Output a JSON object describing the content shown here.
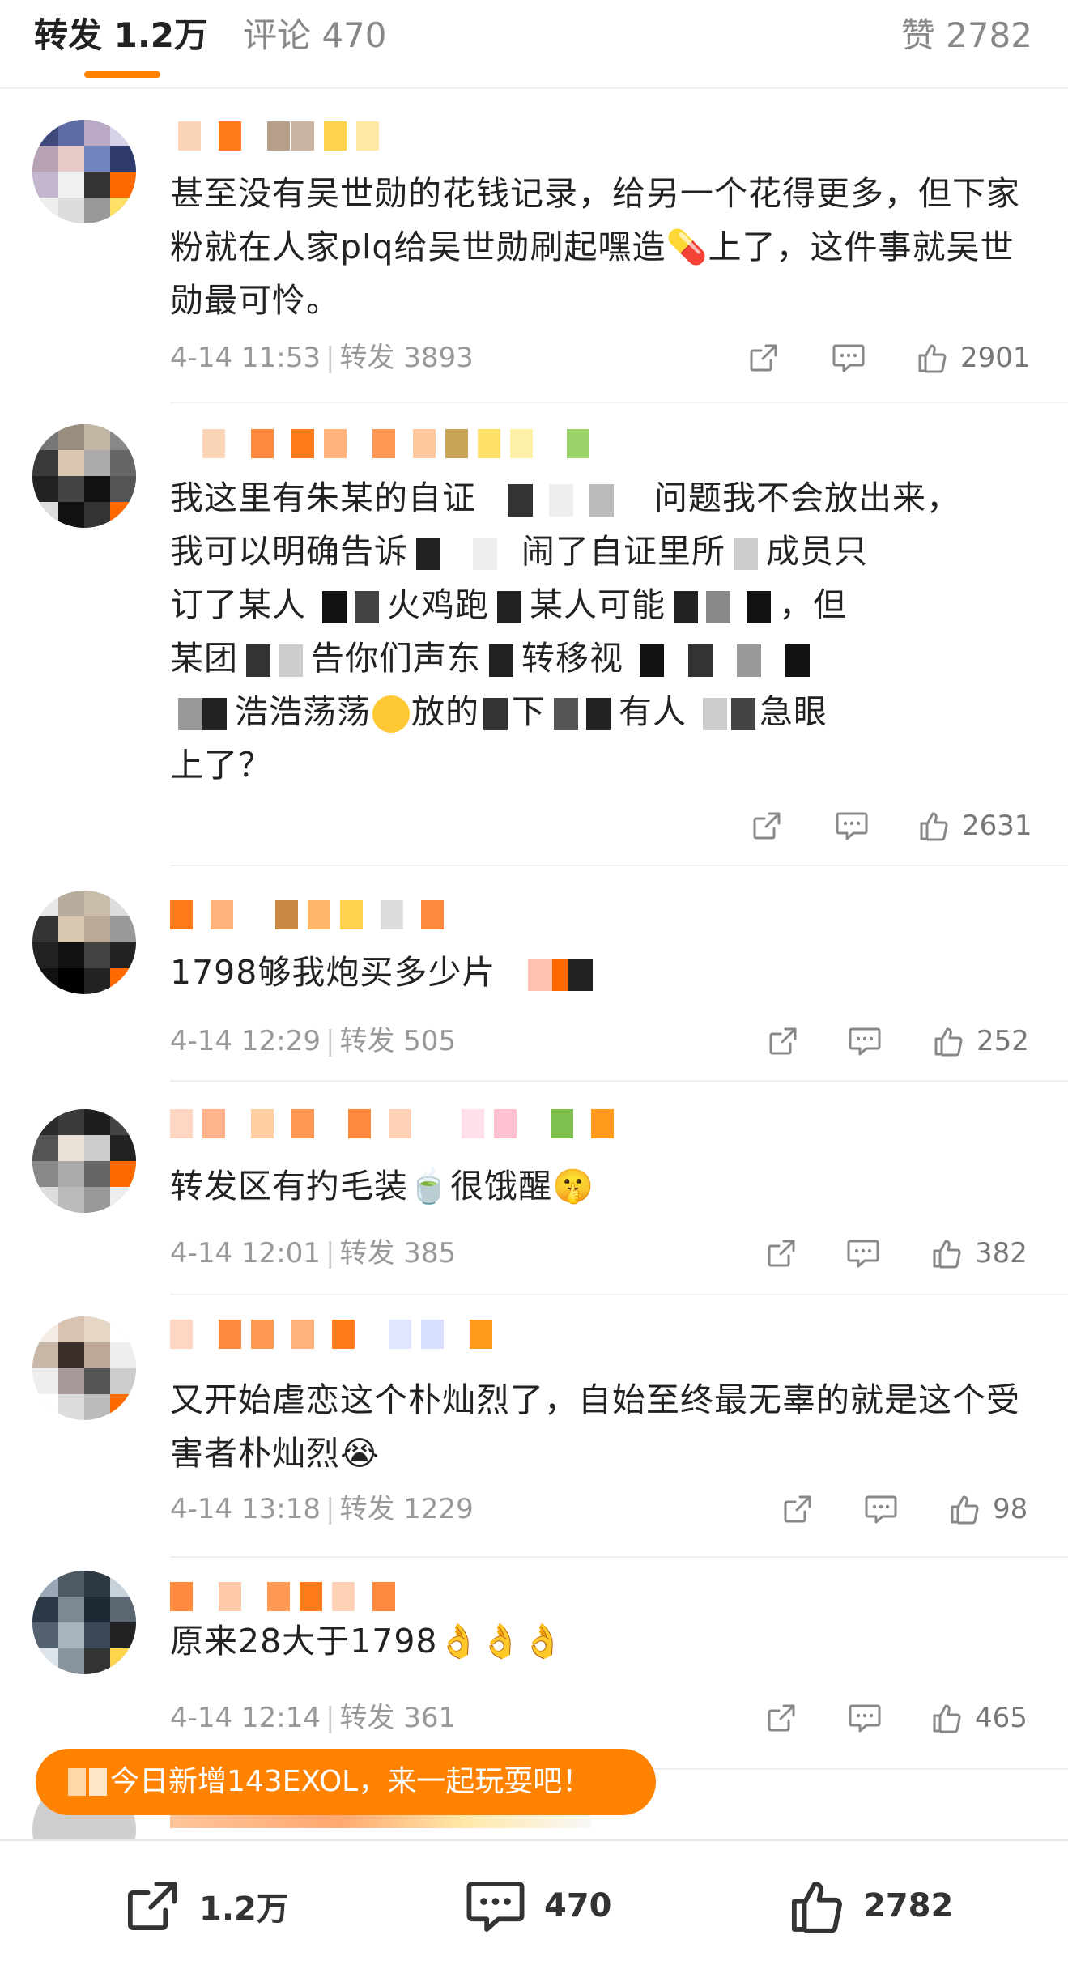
{
  "tabs": {
    "repost_label": "转发 1.2万",
    "comment_label": "评论 470",
    "like_label": "赞 2782"
  },
  "comments": [
    {
      "text": "甚至没有吴世勋的花钱记录，给另一个花得更多，但下家粉就在人家plq给吴世勋刷起嘿造💊上了，这件事就吴世勋最可怜。",
      "date": "4-14 11:53",
      "repost": "转发 3893",
      "likes": "2901"
    },
    {
      "line1": "我这里有朱某的自证",
      "line1b": "问题我不会放出来，",
      "line2a": "我可以明确告诉",
      "line2b": "闹了自证里所",
      "line2c": "成员只",
      "line3a": "订了某人",
      "line3b": "火鸡跑",
      "line3c": "某人可能",
      "line3d": "，但",
      "line4a": "某团",
      "line4b": "告你们声东",
      "line4c": "转移视",
      "line5a": "浩浩荡荡",
      "line5b": "放的",
      "line5c": "下",
      "line5d": "有人",
      "line5e": "急眼",
      "line6": "上了？",
      "likes": "2631"
    },
    {
      "text": "1798够我炮买多少片",
      "date": "4-14 12:29",
      "repost": "转发 505",
      "likes": "252"
    },
    {
      "text": "转发区有扚毛装🍵很饿醒🤫",
      "date": "4-14 12:01",
      "repost": "转发 385",
      "likes": "382"
    },
    {
      "text": "又开始虐恋这个朴灿烈了，自始至终最无辜的就是这个受害者朴灿烈😭",
      "date": "4-14 13:18",
      "repost": "转发 1229",
      "likes": "98"
    },
    {
      "text": "原来28大于1798👌👌👌",
      "date": "4-14 12:14",
      "repost": "转发 361",
      "likes": "465"
    }
  ],
  "toast": {
    "text": "今日新增143EXOL，来一起玩耍吧！"
  },
  "bottom_bar": {
    "repost_count": "1.2万",
    "comment_count": "470",
    "like_count": "2782"
  },
  "colors": {
    "accent": "#ff8200",
    "meta": "#999999",
    "text": "#222222"
  },
  "icons": [
    "repost-icon",
    "comment-icon",
    "like-icon"
  ]
}
